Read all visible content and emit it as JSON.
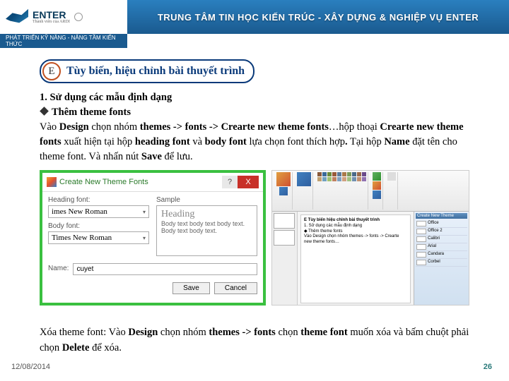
{
  "header": {
    "logo_name": "ENTER",
    "logo_sub": "Thành viên của ARDI",
    "title": "TRUNG TÂM TIN HỌC KIẾN TRÚC - XÂY DỰNG & NGHIỆP VỤ ENTER",
    "tagline": "PHÁT TRIỂN KỸ NĂNG - NÂNG TẦM KIẾN THỨC"
  },
  "section": {
    "badge": "E",
    "title": "Tùy biến, hiệu chỉnh bài thuyết trình"
  },
  "body": {
    "line1": "1.   Sử dụng các mẫu định dạng",
    "line2": "Thêm theme fonts",
    "para": "Vào <b>Design</b> chọn nhóm <b>themes -> fonts -> Crearte new theme fonts</b>…hộp thoại <b>Crearte new theme fonts</b> xuất hiện tại hộp <b>heading font</b> và <b>body font</b> lựa chọn font thích hợp<b>.</b> Tại hộp <b>Name</b> đặt tên cho theme font. Và nhấn nút <b>Save</b> để lưu."
  },
  "dialog": {
    "title": "Create New Theme Fonts",
    "help": "?",
    "close": "X",
    "heading_label": "Heading font:",
    "heading_value": "imes New Roman",
    "body_label": "Body font:",
    "body_value": "Times New Roman",
    "sample_label": "Sample",
    "sample_h": "Heading",
    "sample_b": "Body text body text body text. Body text body text.",
    "name_label": "Name:",
    "name_value": "cuyet",
    "save": "Save",
    "cancel": "Cancel"
  },
  "appshot": {
    "pane_title": "Create New Theme",
    "tp_items": [
      "Office",
      "Office 2",
      "Calibri",
      "Arial",
      "Candara",
      "Corbel"
    ]
  },
  "delete_text": "Xóa theme font: Vào <b>Design</b> chọn nhóm <b>themes -> fonts</b> chọn <b>theme font</b> muốn xóa và bấm chuột phải chọn <b>Delete</b> để xóa.",
  "footer": {
    "date": "12/08/2014",
    "page": "26"
  }
}
